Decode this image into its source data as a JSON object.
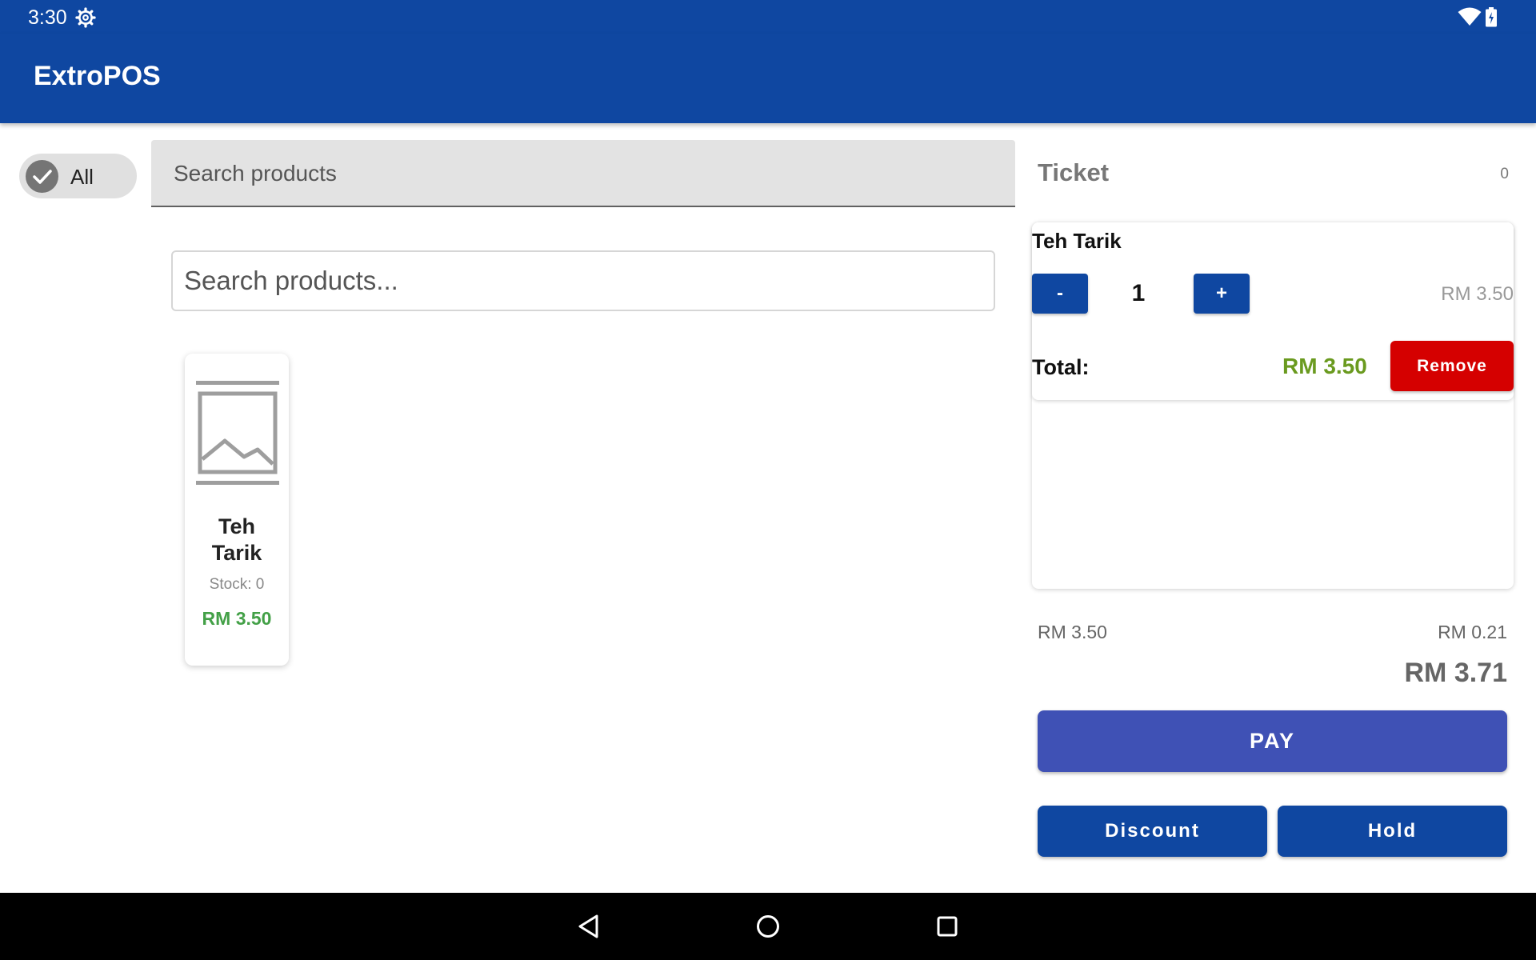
{
  "status_bar": {
    "time": "3:30",
    "icons": [
      "settings-icon",
      "wifi-icon",
      "battery-icon"
    ]
  },
  "app_bar": {
    "title": "ExtroPOS"
  },
  "filter": {
    "chip_label": "All",
    "chip_selected": true
  },
  "search": {
    "filled_placeholder": "Search products",
    "outlined_placeholder": "Search products..."
  },
  "products": [
    {
      "name": "Teh Tarik",
      "stock": "Stock: 0",
      "price": "RM 3.50",
      "image": "image-placeholder-icon"
    }
  ],
  "ticket": {
    "title": "Ticket",
    "count": "0",
    "items": [
      {
        "name": "Teh Tarik",
        "minus_label": "-",
        "plus_label": "+",
        "quantity": "1",
        "unit_price": "RM 3.50",
        "total_label": "Total:",
        "total_value": "RM 3.50",
        "remove_label": "Remove"
      }
    ],
    "subtotal": "RM 3.50",
    "tax": "RM 0.21",
    "grand_total": "RM 3.71"
  },
  "actions": {
    "pay_label": "PAY",
    "discount_label": "Discount",
    "hold_label": "Hold"
  },
  "colors": {
    "primary": "#0f47a1",
    "pay": "#3f51b5",
    "remove": "#d50000",
    "price_green": "#43a047",
    "total_green": "#6a9a1f"
  },
  "nav_bar": {
    "icons": [
      "back-icon",
      "home-icon",
      "recents-icon"
    ]
  }
}
